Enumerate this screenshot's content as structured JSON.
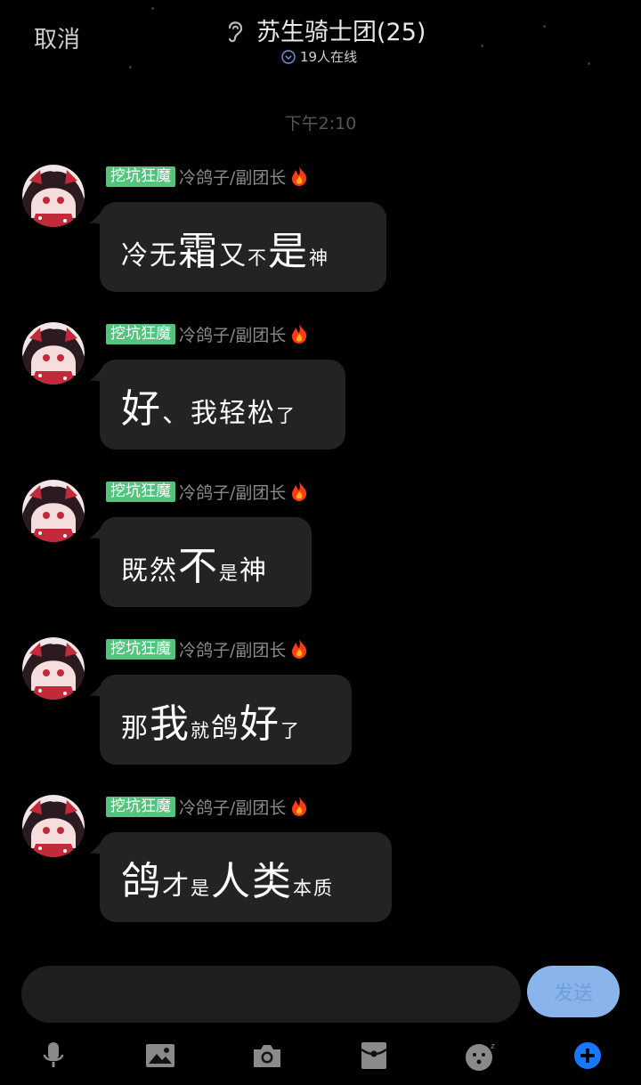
{
  "header": {
    "cancel_label": "取消",
    "title": "苏生骑士团(25)",
    "online_text": "19人在线",
    "ear_icon": "ear-icon",
    "online_icon": "chevron-circle-down-icon"
  },
  "timestamp": "下午2:10",
  "messages": [
    {
      "badge": "挖坑狂魔",
      "sender": "冷鸽子/副团长",
      "segments": [
        {
          "t": "冷",
          "s": "m"
        },
        {
          "t": "无",
          "s": "m"
        },
        {
          "t": "霜",
          "s": "l"
        },
        {
          "t": "又",
          "s": "m"
        },
        {
          "t": "不",
          "s": "s"
        },
        {
          "t": "是",
          "s": "l"
        },
        {
          "t": "神",
          "s": "s"
        }
      ]
    },
    {
      "badge": "挖坑狂魔",
      "sender": "冷鸽子/副团长",
      "segments": [
        {
          "t": "好",
          "s": "l"
        },
        {
          "t": "、",
          "s": "m"
        },
        {
          "t": "我",
          "s": "m"
        },
        {
          "t": "轻",
          "s": "m"
        },
        {
          "t": "松",
          "s": "m"
        },
        {
          "t": "了",
          "s": "s"
        }
      ]
    },
    {
      "badge": "挖坑狂魔",
      "sender": "冷鸽子/副团长",
      "segments": [
        {
          "t": "既",
          "s": "m"
        },
        {
          "t": "然",
          "s": "m"
        },
        {
          "t": "不",
          "s": "l"
        },
        {
          "t": "是",
          "s": "s"
        },
        {
          "t": "神",
          "s": "m"
        }
      ]
    },
    {
      "badge": "挖坑狂魔",
      "sender": "冷鸽子/副团长",
      "segments": [
        {
          "t": "那",
          "s": "m"
        },
        {
          "t": "我",
          "s": "l"
        },
        {
          "t": "就",
          "s": "s"
        },
        {
          "t": "鸽",
          "s": "m"
        },
        {
          "t": "好",
          "s": "l"
        },
        {
          "t": "了",
          "s": "s"
        }
      ]
    },
    {
      "badge": "挖坑狂魔",
      "sender": "冷鸽子/副团长",
      "segments": [
        {
          "t": "鸽",
          "s": "l"
        },
        {
          "t": "才",
          "s": "m"
        },
        {
          "t": "是",
          "s": "s"
        },
        {
          "t": "人",
          "s": "l"
        },
        {
          "t": "类",
          "s": "l"
        },
        {
          "t": "本",
          "s": "s"
        },
        {
          "t": "质",
          "s": "s"
        }
      ]
    }
  ],
  "composer": {
    "input_value": "",
    "send_label": "发送"
  },
  "toolbar": [
    {
      "name": "microphone-icon"
    },
    {
      "name": "image-icon"
    },
    {
      "name": "camera-icon"
    },
    {
      "name": "red-packet-icon"
    },
    {
      "name": "emoji-icon"
    },
    {
      "name": "plus-icon"
    }
  ],
  "colors": {
    "background": "#000000",
    "bubble": "#232323",
    "badge": "#54c37e",
    "send_button": "#8ab5ec",
    "plus_accent": "#1677ff"
  }
}
